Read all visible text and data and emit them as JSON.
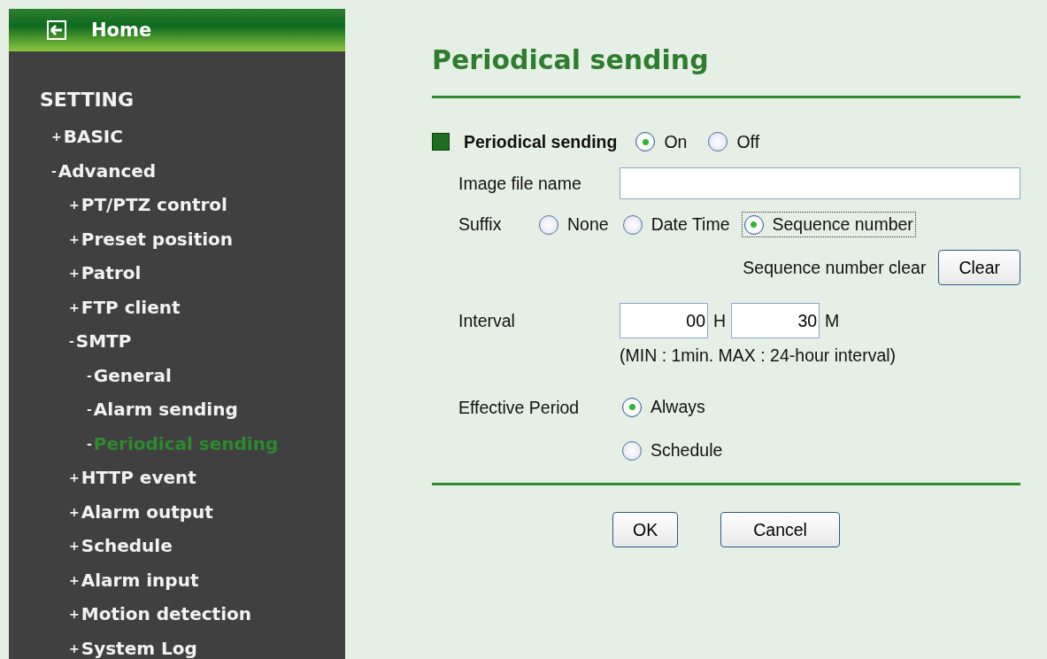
{
  "sidebar": {
    "home": {
      "label": "Home"
    },
    "heading": "SETTING",
    "items": [
      {
        "sign": "+",
        "label": "BASIC",
        "selected": false
      },
      {
        "sign": "-",
        "label": "Advanced",
        "selected": false,
        "children": [
          {
            "sign": "+",
            "label": "PT/PTZ control",
            "selected": false
          },
          {
            "sign": "+",
            "label": "Preset position",
            "selected": false
          },
          {
            "sign": "+",
            "label": "Patrol",
            "selected": false
          },
          {
            "sign": "+",
            "label": "FTP client",
            "selected": false
          },
          {
            "sign": "-",
            "label": "SMTP",
            "selected": false,
            "children": [
              {
                "sign": "-",
                "label": "General",
                "selected": false
              },
              {
                "sign": "-",
                "label": "Alarm sending",
                "selected": false
              },
              {
                "sign": "-",
                "label": "Periodical sending",
                "selected": true
              }
            ]
          },
          {
            "sign": "+",
            "label": "HTTP event",
            "selected": false
          },
          {
            "sign": "+",
            "label": "Alarm output",
            "selected": false
          },
          {
            "sign": "+",
            "label": "Schedule",
            "selected": false
          },
          {
            "sign": "+",
            "label": "Alarm input",
            "selected": false
          },
          {
            "sign": "+",
            "label": "Motion detection",
            "selected": false
          },
          {
            "sign": "+",
            "label": "System Log",
            "selected": false
          }
        ]
      }
    ]
  },
  "main": {
    "title": "Periodical sending",
    "section": {
      "label": "Periodical sending",
      "options": [
        {
          "label": "On",
          "selected": true,
          "focused": false
        },
        {
          "label": "Off",
          "selected": false,
          "focused": false
        }
      ]
    },
    "image_file_name": {
      "label": "Image file name"
    },
    "suffix": {
      "label": "Suffix",
      "options": [
        {
          "label": "None",
          "selected": false,
          "focused": false
        },
        {
          "label": "Date Time",
          "selected": false,
          "focused": false
        },
        {
          "label": "Sequence number",
          "selected": true,
          "focused": true
        }
      ]
    },
    "sequence_clear": {
      "label": "Sequence number clear",
      "button": "Clear"
    },
    "interval": {
      "label": "Interval",
      "hours": "00",
      "hours_unit": "H",
      "minutes": "30",
      "minutes_unit": "M",
      "hint": "(MIN : 1min. MAX : 24-hour interval)"
    },
    "effective_period": {
      "label": "Effective Period",
      "options": [
        {
          "label": "Always",
          "selected": true,
          "focused": false
        },
        {
          "label": "Schedule",
          "selected": false,
          "focused": false
        }
      ]
    },
    "buttons": [
      "OK",
      "Cancel"
    ]
  }
}
